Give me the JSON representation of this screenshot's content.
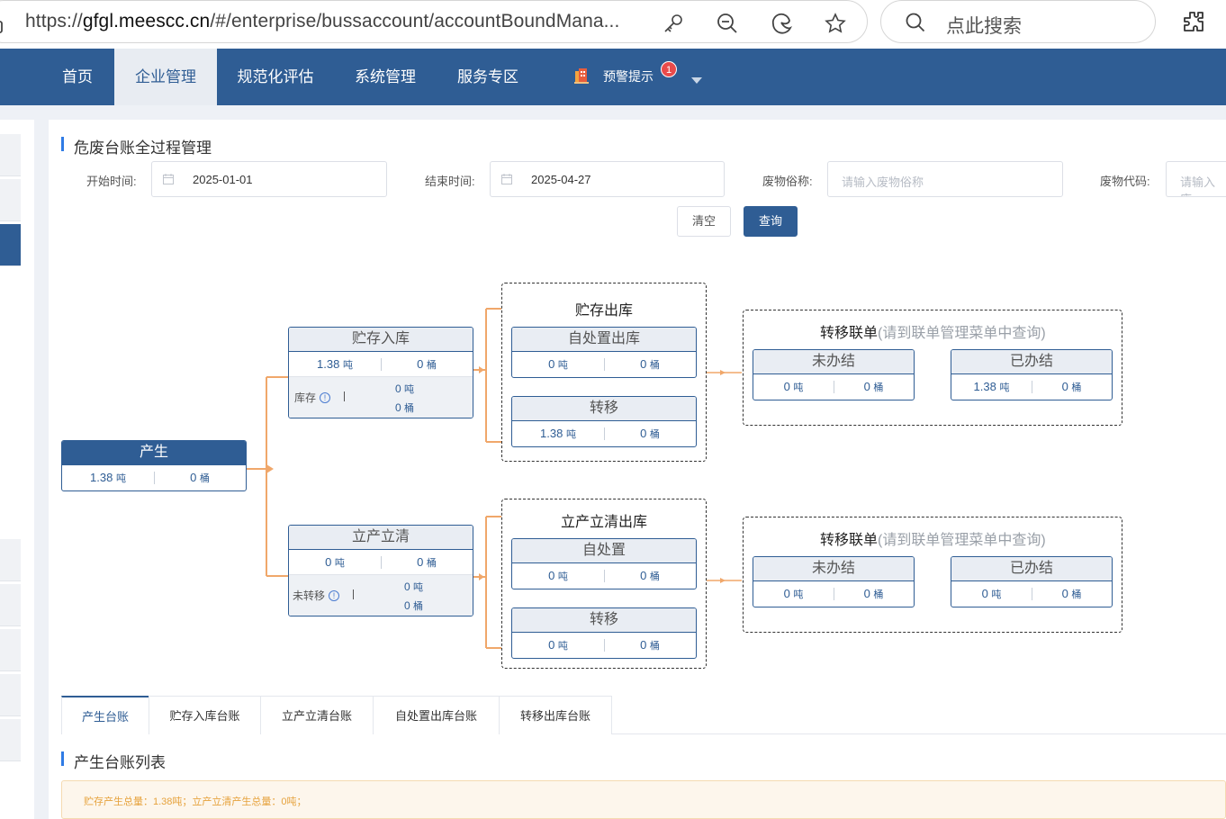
{
  "browser": {
    "url_prefix": "https://",
    "url_domain": "gfgl.meescc.cn",
    "url_path": "/#/enterprise/bussaccount/accountBoundMana...",
    "search_placeholder": "点此搜索"
  },
  "nav": {
    "items": [
      {
        "label": "首页"
      },
      {
        "label": "企业管理"
      },
      {
        "label": "规范化评估"
      },
      {
        "label": "系统管理"
      },
      {
        "label": "服务专区"
      }
    ],
    "warning_label": "预警提示",
    "warning_count": "1"
  },
  "page": {
    "title": "危废台账全过程管理",
    "filters": {
      "start_label": "开始时间:",
      "start_value": "2025-01-01",
      "end_label": "结束时间:",
      "end_value": "2025-04-27",
      "name_label": "废物俗称:",
      "name_placeholder": "请输入废物俗称",
      "code_label": "废物代码:",
      "code_placeholder": "请输入废"
    },
    "clear_label": "清空",
    "query_label": "查询"
  },
  "flow": {
    "unit_ton": "吨",
    "unit_barrel": "桶",
    "produce": {
      "title": "产生",
      "ton": "1.38",
      "barrel": "0"
    },
    "storage_in": {
      "title": "贮存入库",
      "ton": "1.38",
      "barrel": "0",
      "sub_label": "库存",
      "sub_ton": "0",
      "sub_barrel": "0"
    },
    "immediate": {
      "title": "立产立清",
      "ton": "0",
      "barrel": "0",
      "sub_label": "未转移",
      "sub_ton": "0",
      "sub_barrel": "0"
    },
    "storage_out": {
      "title": "贮存出库",
      "self": {
        "title": "自处置出库",
        "ton": "0",
        "barrel": "0"
      },
      "transfer": {
        "title": "转移",
        "ton": "1.38",
        "barrel": "0"
      }
    },
    "immediate_out": {
      "title": "立产立清出库",
      "self": {
        "title": "自处置",
        "ton": "0",
        "barrel": "0"
      },
      "transfer": {
        "title": "转移",
        "ton": "0",
        "barrel": "0"
      }
    },
    "manifest_top": {
      "title": "转移联单",
      "hint": "(请到联单管理菜单中查询)",
      "pending": {
        "title": "未办结",
        "ton": "0",
        "barrel": "0"
      },
      "done": {
        "title": "已办结",
        "ton": "1.38",
        "barrel": "0"
      }
    },
    "manifest_bottom": {
      "title": "转移联单",
      "hint": "(请到联单管理菜单中查询)",
      "pending": {
        "title": "未办结",
        "ton": "0",
        "barrel": "0"
      },
      "done": {
        "title": "已办结",
        "ton": "0",
        "barrel": "0"
      }
    }
  },
  "tabs": [
    {
      "label": "产生台账"
    },
    {
      "label": "贮存入库台账"
    },
    {
      "label": "立产立清台账"
    },
    {
      "label": "自处置出库台账"
    },
    {
      "label": "转移出库台账"
    }
  ],
  "list": {
    "title": "产生台账列表",
    "notice": "贮存产生总量：1.38吨；立产立清产生总量：0吨；"
  },
  "colors": {
    "primary": "#2f5d94",
    "connector": "#f0a76a",
    "badge": "#e94b4b"
  }
}
